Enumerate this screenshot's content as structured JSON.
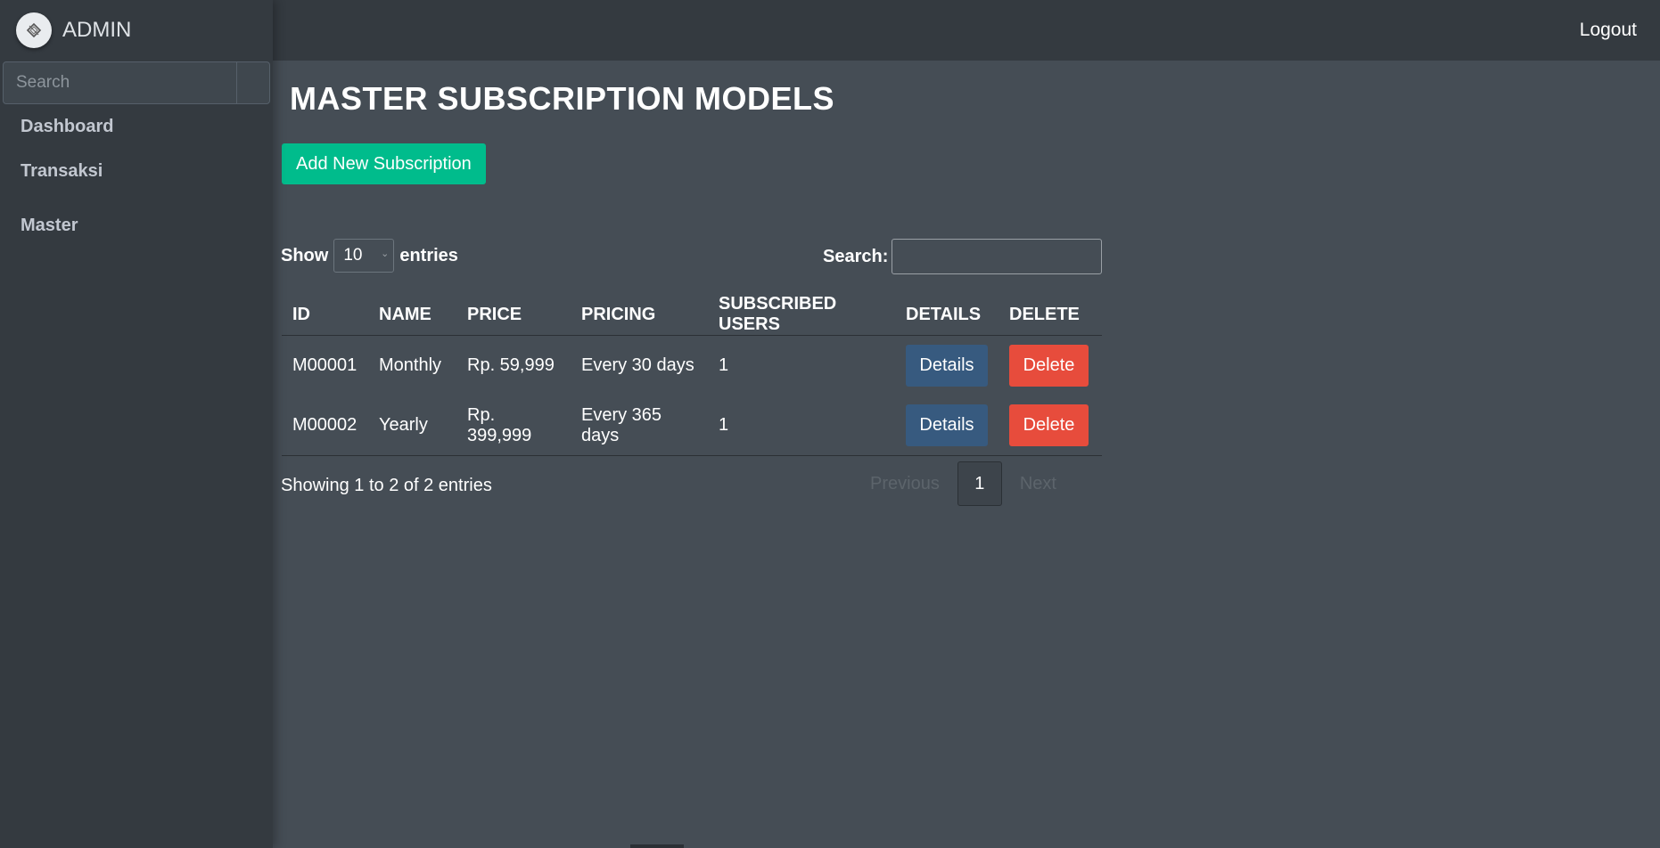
{
  "header": {
    "logout_label": "Logout"
  },
  "sidebar": {
    "brand": "ADMIN",
    "search_placeholder": "Search",
    "items": [
      {
        "label": "Dashboard"
      },
      {
        "label": "Transaksi"
      },
      {
        "label": "Master"
      }
    ]
  },
  "main": {
    "title": "MASTER SUBSCRIPTION MODELS",
    "add_button": "Add New Subscription",
    "show_label": "Show",
    "entries_value": "10",
    "entries_label": "entries",
    "search_label": "Search:",
    "table": {
      "columns": [
        "ID",
        "NAME",
        "PRICE",
        "PRICING",
        "SUBSCRIBED USERS",
        "DETAILS",
        "DELETE"
      ],
      "rows": [
        {
          "id": "M00001",
          "name": "Monthly",
          "price": "Rp. 59,999",
          "pricing": "Every 30 days",
          "users": "1",
          "details": "Details",
          "delete": "Delete"
        },
        {
          "id": "M00002",
          "name": "Yearly",
          "price": "Rp. 399,999",
          "pricing": "Every 365 days",
          "users": "1",
          "details": "Details",
          "delete": "Delete"
        }
      ]
    },
    "info": "Showing 1 to 2 of 2 entries",
    "pagination": {
      "previous": "Previous",
      "current": "1",
      "next": "Next"
    }
  },
  "colors": {
    "background": "#454d55",
    "sidebar": "#343a40",
    "success": "#00bc8c",
    "primary": "#375a7f",
    "danger": "#e74c3c"
  }
}
